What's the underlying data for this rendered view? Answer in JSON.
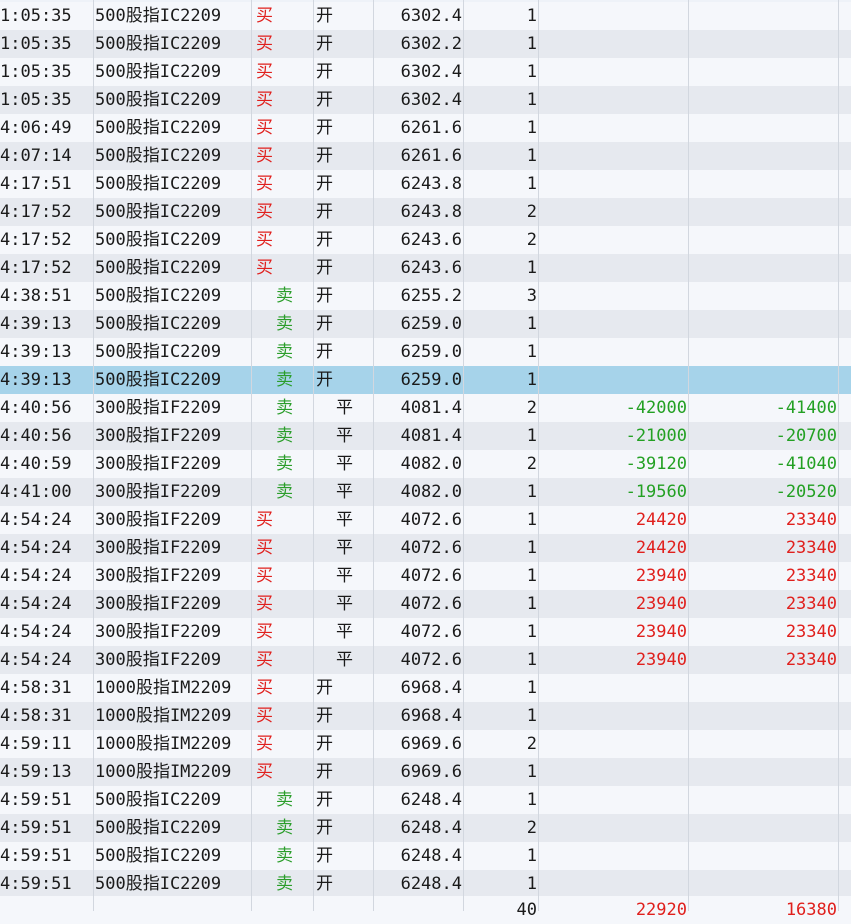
{
  "rows": [
    {
      "time": "1:05:35",
      "name": "500股指IC2209",
      "dir": "买",
      "dir_type": "buy",
      "oc": "开",
      "oc_type": "open",
      "price": "6302.4",
      "qty": "1",
      "p1": "",
      "p1_class": "",
      "p2": "",
      "p2_class": ""
    },
    {
      "time": "1:05:35",
      "name": "500股指IC2209",
      "dir": "买",
      "dir_type": "buy",
      "oc": "开",
      "oc_type": "open",
      "price": "6302.2",
      "qty": "1",
      "p1": "",
      "p1_class": "",
      "p2": "",
      "p2_class": ""
    },
    {
      "time": "1:05:35",
      "name": "500股指IC2209",
      "dir": "买",
      "dir_type": "buy",
      "oc": "开",
      "oc_type": "open",
      "price": "6302.4",
      "qty": "1",
      "p1": "",
      "p1_class": "",
      "p2": "",
      "p2_class": ""
    },
    {
      "time": "1:05:35",
      "name": "500股指IC2209",
      "dir": "买",
      "dir_type": "buy",
      "oc": "开",
      "oc_type": "open",
      "price": "6302.4",
      "qty": "1",
      "p1": "",
      "p1_class": "",
      "p2": "",
      "p2_class": ""
    },
    {
      "time": "4:06:49",
      "name": "500股指IC2209",
      "dir": "买",
      "dir_type": "buy",
      "oc": "开",
      "oc_type": "open",
      "price": "6261.6",
      "qty": "1",
      "p1": "",
      "p1_class": "",
      "p2": "",
      "p2_class": ""
    },
    {
      "time": "4:07:14",
      "name": "500股指IC2209",
      "dir": "买",
      "dir_type": "buy",
      "oc": "开",
      "oc_type": "open",
      "price": "6261.6",
      "qty": "1",
      "p1": "",
      "p1_class": "",
      "p2": "",
      "p2_class": ""
    },
    {
      "time": "4:17:51",
      "name": "500股指IC2209",
      "dir": "买",
      "dir_type": "buy",
      "oc": "开",
      "oc_type": "open",
      "price": "6243.8",
      "qty": "1",
      "p1": "",
      "p1_class": "",
      "p2": "",
      "p2_class": ""
    },
    {
      "time": "4:17:52",
      "name": "500股指IC2209",
      "dir": "买",
      "dir_type": "buy",
      "oc": "开",
      "oc_type": "open",
      "price": "6243.8",
      "qty": "2",
      "p1": "",
      "p1_class": "",
      "p2": "",
      "p2_class": ""
    },
    {
      "time": "4:17:52",
      "name": "500股指IC2209",
      "dir": "买",
      "dir_type": "buy",
      "oc": "开",
      "oc_type": "open",
      "price": "6243.6",
      "qty": "2",
      "p1": "",
      "p1_class": "",
      "p2": "",
      "p2_class": ""
    },
    {
      "time": "4:17:52",
      "name": "500股指IC2209",
      "dir": "买",
      "dir_type": "buy",
      "oc": "开",
      "oc_type": "open",
      "price": "6243.6",
      "qty": "1",
      "p1": "",
      "p1_class": "",
      "p2": "",
      "p2_class": ""
    },
    {
      "time": "4:38:51",
      "name": "500股指IC2209",
      "dir": "卖",
      "dir_type": "sell",
      "oc": "开",
      "oc_type": "open",
      "price": "6255.2",
      "qty": "3",
      "p1": "",
      "p1_class": "",
      "p2": "",
      "p2_class": ""
    },
    {
      "time": "4:39:13",
      "name": "500股指IC2209",
      "dir": "卖",
      "dir_type": "sell",
      "oc": "开",
      "oc_type": "open",
      "price": "6259.0",
      "qty": "1",
      "p1": "",
      "p1_class": "",
      "p2": "",
      "p2_class": ""
    },
    {
      "time": "4:39:13",
      "name": "500股指IC2209",
      "dir": "卖",
      "dir_type": "sell",
      "oc": "开",
      "oc_type": "open",
      "price": "6259.0",
      "qty": "1",
      "p1": "",
      "p1_class": "",
      "p2": "",
      "p2_class": ""
    },
    {
      "time": "4:39:13",
      "name": "500股指IC2209",
      "dir": "卖",
      "dir_type": "sell",
      "oc": "开",
      "oc_type": "open",
      "price": "6259.0",
      "qty": "1",
      "p1": "",
      "p1_class": "",
      "p2": "",
      "p2_class": "",
      "selected": true
    },
    {
      "time": "4:40:56",
      "name": "300股指IF2209",
      "dir": "卖",
      "dir_type": "sell",
      "oc": "平",
      "oc_type": "close",
      "price": "4081.4",
      "qty": "2",
      "p1": "-42000",
      "p1_class": "neg",
      "p2": "-41400",
      "p2_class": "neg"
    },
    {
      "time": "4:40:56",
      "name": "300股指IF2209",
      "dir": "卖",
      "dir_type": "sell",
      "oc": "平",
      "oc_type": "close",
      "price": "4081.4",
      "qty": "1",
      "p1": "-21000",
      "p1_class": "neg",
      "p2": "-20700",
      "p2_class": "neg"
    },
    {
      "time": "4:40:59",
      "name": "300股指IF2209",
      "dir": "卖",
      "dir_type": "sell",
      "oc": "平",
      "oc_type": "close",
      "price": "4082.0",
      "qty": "2",
      "p1": "-39120",
      "p1_class": "neg",
      "p2": "-41040",
      "p2_class": "neg"
    },
    {
      "time": "4:41:00",
      "name": "300股指IF2209",
      "dir": "卖",
      "dir_type": "sell",
      "oc": "平",
      "oc_type": "close",
      "price": "4082.0",
      "qty": "1",
      "p1": "-19560",
      "p1_class": "neg",
      "p2": "-20520",
      "p2_class": "neg"
    },
    {
      "time": "4:54:24",
      "name": "300股指IF2209",
      "dir": "买",
      "dir_type": "buy",
      "oc": "平",
      "oc_type": "close",
      "price": "4072.6",
      "qty": "1",
      "p1": "24420",
      "p1_class": "pos",
      "p2": "23340",
      "p2_class": "pos"
    },
    {
      "time": "4:54:24",
      "name": "300股指IF2209",
      "dir": "买",
      "dir_type": "buy",
      "oc": "平",
      "oc_type": "close",
      "price": "4072.6",
      "qty": "1",
      "p1": "24420",
      "p1_class": "pos",
      "p2": "23340",
      "p2_class": "pos"
    },
    {
      "time": "4:54:24",
      "name": "300股指IF2209",
      "dir": "买",
      "dir_type": "buy",
      "oc": "平",
      "oc_type": "close",
      "price": "4072.6",
      "qty": "1",
      "p1": "23940",
      "p1_class": "pos",
      "p2": "23340",
      "p2_class": "pos"
    },
    {
      "time": "4:54:24",
      "name": "300股指IF2209",
      "dir": "买",
      "dir_type": "buy",
      "oc": "平",
      "oc_type": "close",
      "price": "4072.6",
      "qty": "1",
      "p1": "23940",
      "p1_class": "pos",
      "p2": "23340",
      "p2_class": "pos"
    },
    {
      "time": "4:54:24",
      "name": "300股指IF2209",
      "dir": "买",
      "dir_type": "buy",
      "oc": "平",
      "oc_type": "close",
      "price": "4072.6",
      "qty": "1",
      "p1": "23940",
      "p1_class": "pos",
      "p2": "23340",
      "p2_class": "pos"
    },
    {
      "time": "4:54:24",
      "name": "300股指IF2209",
      "dir": "买",
      "dir_type": "buy",
      "oc": "平",
      "oc_type": "close",
      "price": "4072.6",
      "qty": "1",
      "p1": "23940",
      "p1_class": "pos",
      "p2": "23340",
      "p2_class": "pos"
    },
    {
      "time": "4:58:31",
      "name": "1000股指IM2209",
      "dir": "买",
      "dir_type": "buy",
      "oc": "开",
      "oc_type": "open",
      "price": "6968.4",
      "qty": "1",
      "p1": "",
      "p1_class": "",
      "p2": "",
      "p2_class": ""
    },
    {
      "time": "4:58:31",
      "name": "1000股指IM2209",
      "dir": "买",
      "dir_type": "buy",
      "oc": "开",
      "oc_type": "open",
      "price": "6968.4",
      "qty": "1",
      "p1": "",
      "p1_class": "",
      "p2": "",
      "p2_class": ""
    },
    {
      "time": "4:59:11",
      "name": "1000股指IM2209",
      "dir": "买",
      "dir_type": "buy",
      "oc": "开",
      "oc_type": "open",
      "price": "6969.6",
      "qty": "2",
      "p1": "",
      "p1_class": "",
      "p2": "",
      "p2_class": ""
    },
    {
      "time": "4:59:13",
      "name": "1000股指IM2209",
      "dir": "买",
      "dir_type": "buy",
      "oc": "开",
      "oc_type": "open",
      "price": "6969.6",
      "qty": "1",
      "p1": "",
      "p1_class": "",
      "p2": "",
      "p2_class": ""
    },
    {
      "time": "4:59:51",
      "name": "500股指IC2209",
      "dir": "卖",
      "dir_type": "sell",
      "oc": "开",
      "oc_type": "open",
      "price": "6248.4",
      "qty": "1",
      "p1": "",
      "p1_class": "",
      "p2": "",
      "p2_class": ""
    },
    {
      "time": "4:59:51",
      "name": "500股指IC2209",
      "dir": "卖",
      "dir_type": "sell",
      "oc": "开",
      "oc_type": "open",
      "price": "6248.4",
      "qty": "2",
      "p1": "",
      "p1_class": "",
      "p2": "",
      "p2_class": ""
    },
    {
      "time": "4:59:51",
      "name": "500股指IC2209",
      "dir": "卖",
      "dir_type": "sell",
      "oc": "开",
      "oc_type": "open",
      "price": "6248.4",
      "qty": "1",
      "p1": "",
      "p1_class": "",
      "p2": "",
      "p2_class": ""
    },
    {
      "time": "4:59:51",
      "name": "500股指IC2209",
      "dir": "卖",
      "dir_type": "sell",
      "oc": "开",
      "oc_type": "open",
      "price": "6248.4",
      "qty": "1",
      "p1": "",
      "p1_class": "",
      "p2": "",
      "p2_class": ""
    }
  ],
  "summary": {
    "qty": "40",
    "p1": "22920",
    "p2": "16380"
  },
  "colors": {
    "buy": "#e0201d",
    "sell": "#2a9d2a",
    "selected": "#a6d3ea"
  }
}
